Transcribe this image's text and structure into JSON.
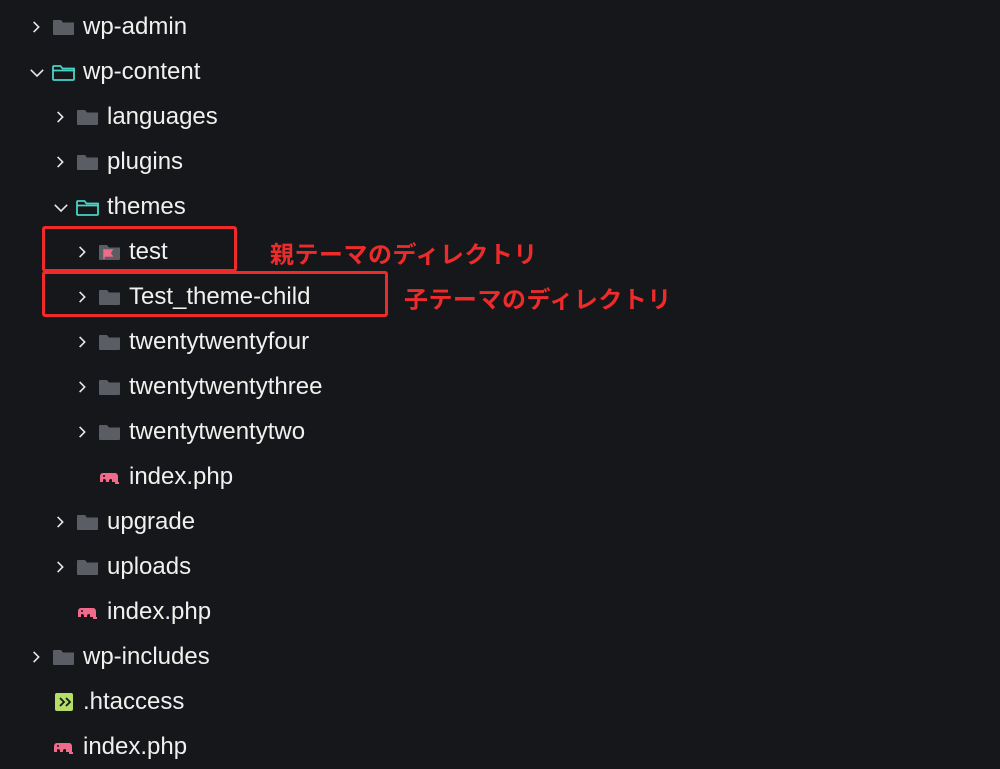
{
  "tree": {
    "wp_admin": "wp-admin",
    "wp_content": "wp-content",
    "languages": "languages",
    "plugins": "plugins",
    "themes": "themes",
    "test": "test",
    "test_theme_child": "Test_theme-child",
    "twentytwentyfour": "twentytwentyfour",
    "twentytwentythree": "twentytwentythree",
    "twentytwentytwo": "twentytwentytwo",
    "index_php_themes": "index.php",
    "upgrade": "upgrade",
    "uploads": "uploads",
    "index_php_wpcontent": "index.php",
    "wp_includes": "wp-includes",
    "htaccess": ".htaccess",
    "index_php_root": "index.php"
  },
  "annotations": {
    "parent": "親テーマのディレクトリ",
    "child": "子テーマのディレクトリ"
  },
  "colors": {
    "annotation": "#ed2b2b",
    "accent_folder": "#49d4c6",
    "php": "#f06a8a"
  }
}
